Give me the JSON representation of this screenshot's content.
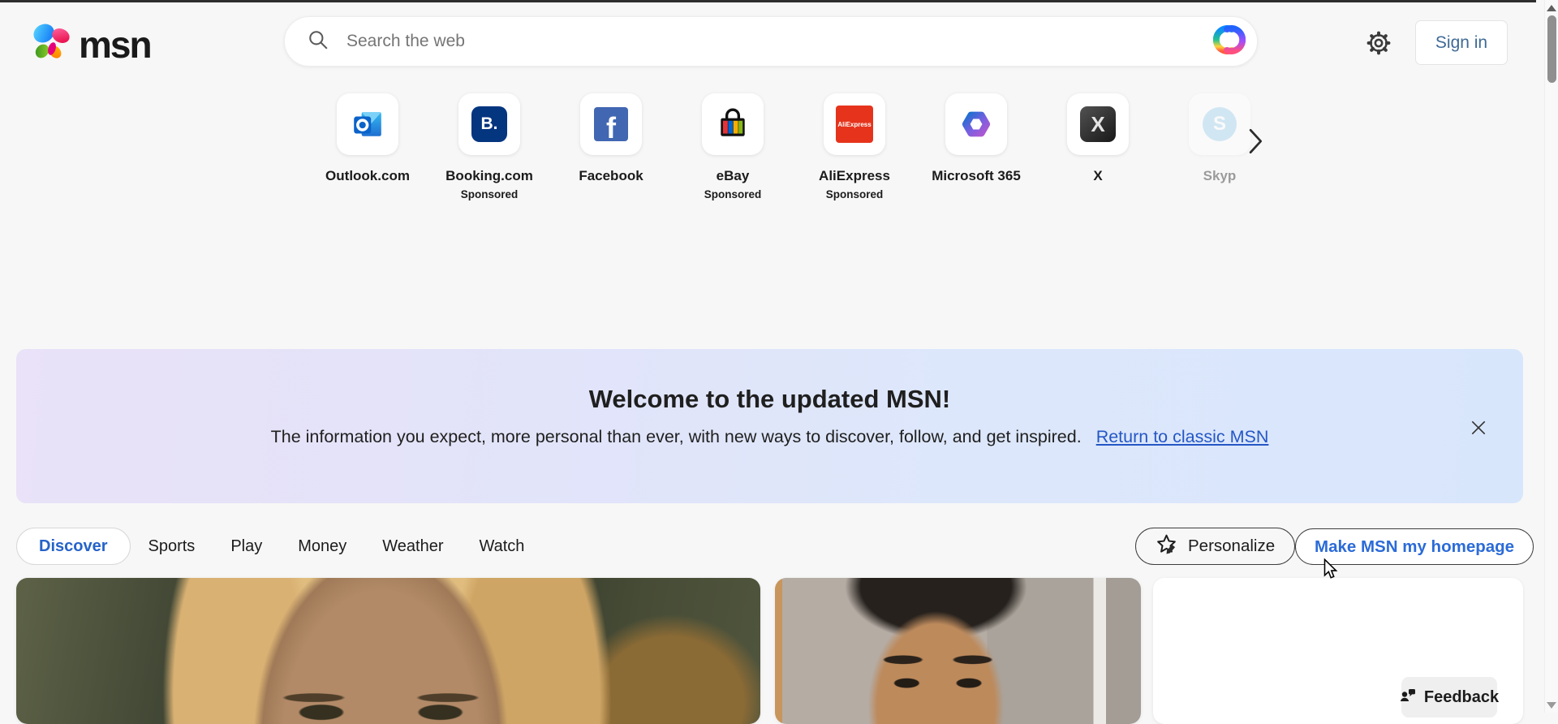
{
  "header": {
    "logo_text": "msn",
    "search": {
      "placeholder": "Search the web"
    },
    "sign_in_label": "Sign in"
  },
  "quick_links": {
    "items": [
      {
        "label": "Outlook.com",
        "icon": "outlook-icon"
      },
      {
        "label": "Booking.com",
        "icon": "booking-icon",
        "icon_text": "B.",
        "sponsored": "Sponsored"
      },
      {
        "label": "Facebook",
        "icon": "facebook-icon",
        "icon_text": "f"
      },
      {
        "label": "eBay",
        "icon": "ebay-icon",
        "sponsored": "Sponsored"
      },
      {
        "label": "AliExpress",
        "icon": "aliexpress-icon",
        "icon_text": "AliExpress",
        "sponsored": "Sponsored"
      },
      {
        "label": "Microsoft 365",
        "icon": "microsoft365-icon"
      },
      {
        "label": "X",
        "icon": "x-icon",
        "icon_text": "X"
      },
      {
        "label": "Skyp",
        "icon": "skype-icon",
        "icon_text": "S",
        "faded": true
      }
    ]
  },
  "banner": {
    "title": "Welcome to the updated MSN!",
    "subtitle": "The information you expect, more personal than ever, with new ways to discover, follow, and get inspired.",
    "link_label": "Return to classic MSN",
    "gradient_left": "#e9e2f8",
    "gradient_right": "#d8e6fc"
  },
  "nav": {
    "tabs": [
      {
        "label": "Discover",
        "active": true
      },
      {
        "label": "Sports"
      },
      {
        "label": "Play"
      },
      {
        "label": "Money"
      },
      {
        "label": "Weather"
      },
      {
        "label": "Watch"
      }
    ],
    "personalize_label": "Personalize",
    "homepage_label": "Make MSN my homepage"
  },
  "feedback": {
    "label": "Feedback"
  },
  "colors": {
    "page_bg": "#f7f7f7",
    "accent_blue": "#2563c9",
    "link_blue": "#2457c5",
    "sign_in_blue": "#3f6a96",
    "booking_blue": "#04357f",
    "facebook_blue": "#4267b2",
    "aliexpress_red": "#e6341c"
  }
}
